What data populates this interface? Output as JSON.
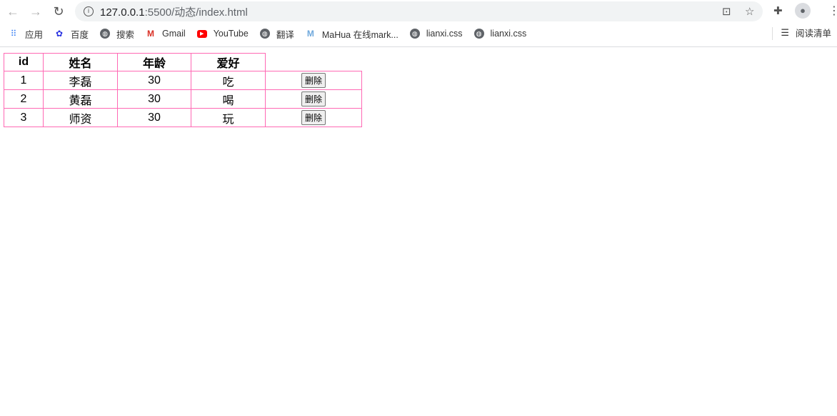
{
  "browser": {
    "url_host": "127.0.0.1",
    "url_rest": ":5500/动态/index.html",
    "bookmarks": [
      {
        "label": "应用",
        "icon": "apps-grid-icon"
      },
      {
        "label": "百度",
        "icon": "baidu-paw-icon"
      },
      {
        "label": "搜索",
        "icon": "globe-icon"
      },
      {
        "label": "Gmail",
        "icon": "gmail-icon"
      },
      {
        "label": "YouTube",
        "icon": "youtube-icon"
      },
      {
        "label": "翻译",
        "icon": "globe-icon"
      },
      {
        "label": "MaHua 在线mark...",
        "icon": "mahua-icon"
      },
      {
        "label": "lianxi.css",
        "icon": "globe-icon"
      },
      {
        "label": "lianxi.css",
        "icon": "globe-icon"
      }
    ],
    "reading_list": "阅读清单"
  },
  "table": {
    "border_color": "#ff69b4",
    "headers": [
      "id",
      "姓名",
      "年龄",
      "爱好"
    ],
    "rows": [
      {
        "id": "1",
        "name": "李磊",
        "age": "30",
        "hobby": "吃",
        "action": "删除"
      },
      {
        "id": "2",
        "name": "黄磊",
        "age": "30",
        "hobby": "喝",
        "action": "删除"
      },
      {
        "id": "3",
        "name": "师资",
        "age": "30",
        "hobby": "玩",
        "action": "删除"
      }
    ]
  }
}
